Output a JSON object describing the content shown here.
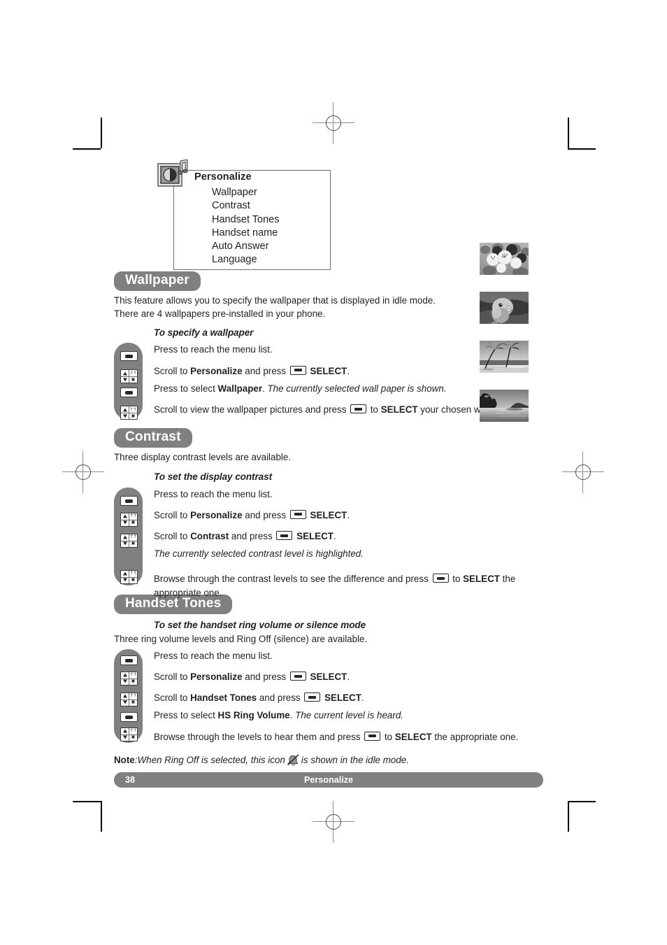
{
  "document": {
    "page_number": "38",
    "footer_section": "Personalize"
  },
  "menu": {
    "icon": "personalize-picture-note-icon",
    "title": "Personalize",
    "items": [
      "Wallpaper",
      "Contrast",
      "Handset Tones",
      "Handset name",
      "Auto Answer",
      "Language"
    ]
  },
  "sections": [
    {
      "heading": "Wallpaper",
      "intro_line1": "This feature allows you to specify the wallpaper that is displayed in idle mode.",
      "intro_line2": "There are 4 wallpapers pre-installed in your phone.",
      "subheading": "To specify a wallpaper",
      "steps": [
        {
          "key": "select",
          "text": "Press to reach the menu list."
        },
        {
          "key": "scroll",
          "text": "Scroll to Personalize and press  SELECT."
        },
        {
          "key": "select",
          "text": "Press to select Wallpaper. The currently selected wall paper is shown."
        },
        {
          "key": "scroll",
          "text": "Scroll to view the wallpaper pictures and press  to SELECT your chosen wallpaper."
        }
      ]
    },
    {
      "heading": "Contrast",
      "intro_line1": "Three display contrast levels are available.",
      "subheading": "To set the display contrast",
      "steps": [
        {
          "key": "select",
          "text": "Press to reach the menu list."
        },
        {
          "key": "scroll",
          "text": "Scroll to Personalize and press  SELECT."
        },
        {
          "key": "scroll",
          "text": "Scroll to Contrast and press  SELECT."
        },
        {
          "key": "none",
          "text": "The currently selected contrast level is highlighted."
        },
        {
          "key": "scroll",
          "text": "Browse through the contrast levels to see the difference and press  to SELECT the appropriate one."
        }
      ]
    },
    {
      "heading": "Handset Tones",
      "subheading": "To set the handset ring volume or silence mode",
      "intro_line1": "Three ring volume levels and Ring Off (silence) are available.",
      "steps": [
        {
          "key": "select",
          "text": "Press to reach the menu list."
        },
        {
          "key": "scroll",
          "text": "Scroll to Personalize and press  SELECT."
        },
        {
          "key": "scroll",
          "text": "Scroll to Handset Tones and press  SELECT."
        },
        {
          "key": "select",
          "text": "Press to select HS Ring Volume. The current level is heard."
        },
        {
          "key": "scroll",
          "text": "Browse through the levels to hear them and press  to SELECT the appropriate one."
        }
      ],
      "note": {
        "label": "Note",
        "before_icon": ":When Ring Off is selected, this icon",
        "icon": "ring-off-bell-icon",
        "after_icon": "is shown in the idle mode."
      }
    }
  ],
  "text_fragments": {
    "s1_step1": "Press to reach the menu list.",
    "s1_step2_a": "Scroll to ",
    "s1_step2_b": "Personalize",
    "s1_step2_c": " and press ",
    "s1_step2_d": "SELECT",
    "s1_step2_e": ".",
    "s1_step3_a": "Press to select ",
    "s1_step3_b": "Wallpaper",
    "s1_step3_c": ". ",
    "s1_step3_d": "The currently selected wall paper is shown.",
    "s1_step4_a": "Scroll to view the wallpaper pictures and press ",
    "s1_step4_b": " to ",
    "s1_step4_c": "SELECT",
    "s1_step4_d": " your chosen wallpaper.",
    "s2_step3_a": "Scroll to ",
    "s2_step3_b": "Contrast",
    "s2_step3_c": " and press ",
    "s2_step3_d": "SELECT",
    "s2_step3_e": ".",
    "s2_step4": "The currently selected contrast level is highlighted.",
    "s2_step5_a": "Browse through the contrast levels to see the difference and press ",
    "s2_step5_b": " to ",
    "s2_step5_c": "SELECT",
    "s2_step5_d": " the appropriate one.",
    "s3_step3_a": "Scroll to ",
    "s3_step3_b": "Handset Tones",
    "s3_step3_c": " and press ",
    "s3_step3_d": "SELECT",
    "s3_step3_e": ".",
    "s3_step4_a": "Press to select ",
    "s3_step4_b": "HS Ring Volume",
    "s3_step4_c": ". ",
    "s3_step4_d": "The current level is heard.",
    "s3_step5_a": "Browse through the levels to hear them and press ",
    "s3_step5_b": " to ",
    "s3_step5_c": "SELECT",
    "s3_step5_d": " the appropriate one."
  },
  "thumbnails": [
    {
      "name": "wallpaper-flowers",
      "caption": "flowers"
    },
    {
      "name": "wallpaper-parrot",
      "caption": "parrot"
    },
    {
      "name": "wallpaper-palm-beach",
      "caption": "palm trees on beach"
    },
    {
      "name": "wallpaper-lake-island",
      "caption": "lake with island"
    }
  ],
  "colors": {
    "pill_gray": "#808080",
    "text": "#231f20",
    "footer_gray": "#808080"
  }
}
